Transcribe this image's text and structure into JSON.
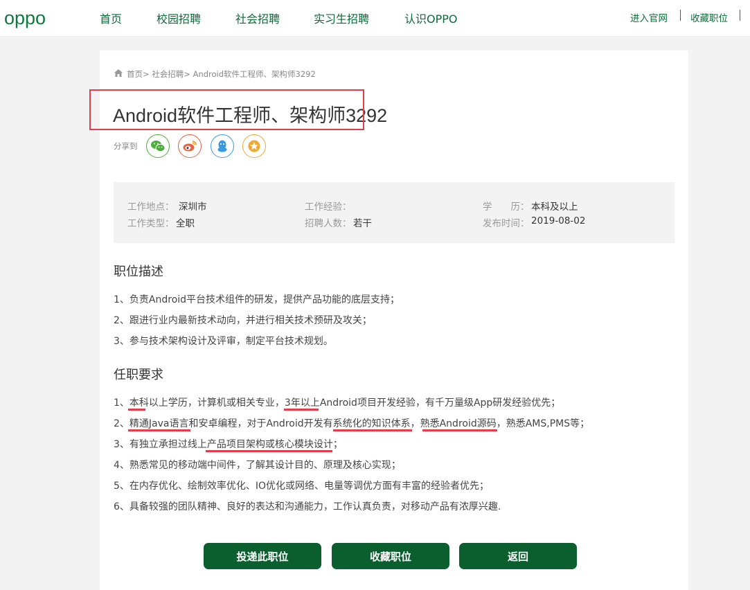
{
  "brand": {
    "logo": "oppo",
    "color": "#0b7a3e"
  },
  "nav": {
    "items": [
      {
        "label": "首页"
      },
      {
        "label": "校园招聘"
      },
      {
        "label": "社会招聘"
      },
      {
        "label": "实习生招聘"
      },
      {
        "label": "认识OPPO"
      }
    ],
    "right": [
      {
        "label": "进入官网"
      },
      {
        "label": "收藏职位"
      }
    ]
  },
  "breadcrumb": {
    "text": "首页> 社会招聘> Android软件工程师、架构师3292"
  },
  "job": {
    "title": "Android软件工程师、架构师3292",
    "share_label": "分享到",
    "share_icons": [
      "wechat-icon",
      "weibo-icon",
      "qq-icon",
      "favorite-icon"
    ],
    "info": {
      "location_label": "工作地点：",
      "location": "深圳市",
      "experience_label": "工作经验：",
      "experience": "",
      "education_label": "学　　历：",
      "education": "本科及以上",
      "type_label": "工作类型：",
      "type": "全职",
      "headcount_label": "招聘人数：",
      "headcount": "若干",
      "date_label": "发布时间：",
      "date": "2019-08-02"
    },
    "description_title": "职位描述",
    "description": [
      "1、负责Android平台技术组件的研发，提供产品功能的底层支持；",
      "2、跟进行业内最新技术动向，并进行相关技术预研及攻关；",
      "3、参与技术架构设计及评审，制定平台技术规划。"
    ],
    "requirements_title": "任职要求",
    "requirements": [
      "1、本科以上学历，计算机或相关专业，3年以上Android项目开发经验，有千万量级App研发经验优先；",
      "2、精通Java语言和安卓编程，对于Android开发有系统化的知识体系，熟悉Android源码，熟悉AMS,PMS等；",
      "3、有独立承担过线上产品项目架构或核心模块设计；",
      "4、熟悉常见的移动端中间件，了解其设计目的、原理及核心实现；",
      "5、在内存优化、绘制效率优化、IO优化或网络、电量等调优方面有丰富的经验者优先；",
      "6、具备较强的团队精神、良好的表达和沟通能力，工作认真负责，对移动产品有浓厚兴趣."
    ]
  },
  "actions": {
    "apply": "投递此职位",
    "favorite": "收藏职位",
    "back": "返回"
  },
  "colors": {
    "accent": "#0b5e2e",
    "annotation": "#e33c4a"
  }
}
